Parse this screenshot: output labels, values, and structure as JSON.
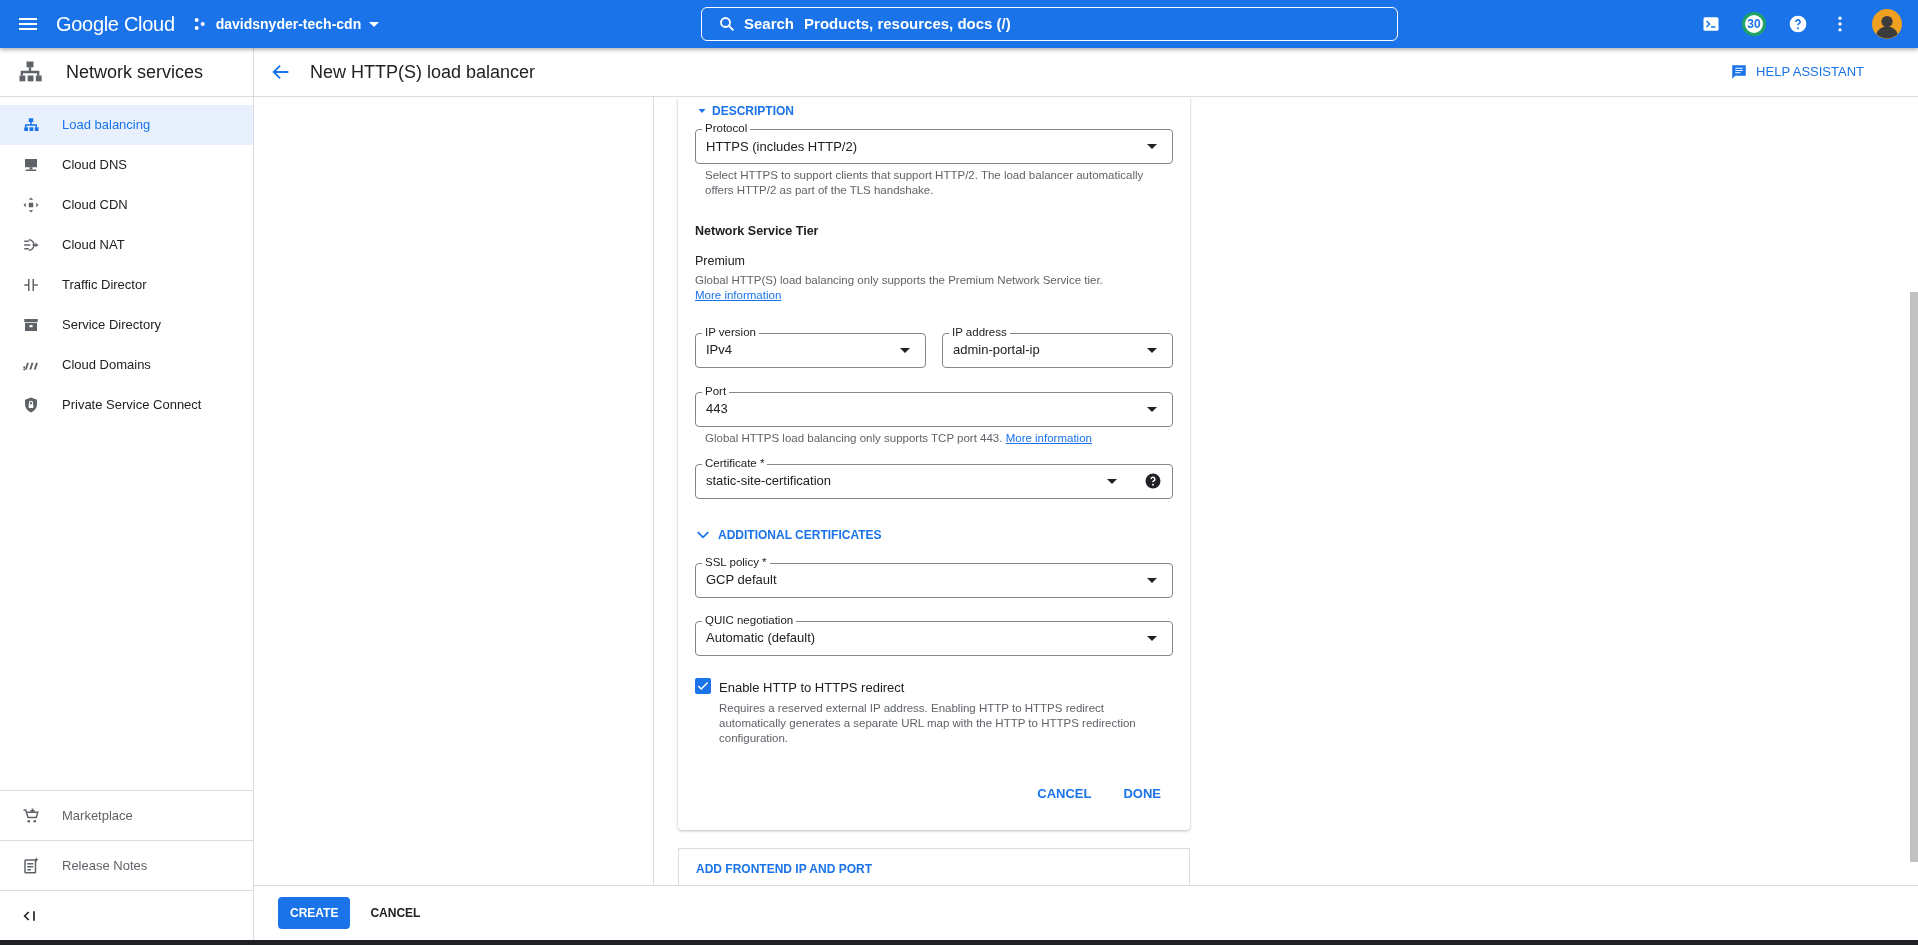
{
  "topbar": {
    "brand": "Google Cloud",
    "project": "davidsnyder-tech-cdn",
    "search": {
      "label": "Search",
      "placeholder": "Products, resources, docs (/)"
    },
    "notifications": "30"
  },
  "sidebar": {
    "title": "Network services",
    "items": [
      {
        "label": "Load balancing",
        "selected": true
      },
      {
        "label": "Cloud DNS",
        "selected": false
      },
      {
        "label": "Cloud CDN",
        "selected": false
      },
      {
        "label": "Cloud NAT",
        "selected": false
      },
      {
        "label": "Traffic Director",
        "selected": false
      },
      {
        "label": "Service Directory",
        "selected": false
      },
      {
        "label": "Cloud Domains",
        "selected": false
      },
      {
        "label": "Private Service Connect",
        "selected": false
      }
    ],
    "footer_items": [
      {
        "label": "Marketplace"
      },
      {
        "label": "Release Notes"
      }
    ]
  },
  "page": {
    "title": "New HTTP(S) load balancer",
    "help": "HELP ASSISTANT"
  },
  "form": {
    "section_toggle": "DESCRIPTION",
    "protocol": {
      "label": "Protocol",
      "value": "HTTPS (includes HTTP/2)",
      "hint": "Select HTTPS to support clients that support HTTP/2. The load balancer automatically offers HTTP/2 as part of the TLS handshake."
    },
    "tier": {
      "heading": "Network Service Tier",
      "value": "Premium",
      "note": "Global HTTP(S) load balancing only supports the Premium Network Service tier.",
      "link": "More information"
    },
    "ip_version": {
      "label": "IP version",
      "value": "IPv4"
    },
    "ip_address": {
      "label": "IP address",
      "value": "admin-portal-ip"
    },
    "port": {
      "label": "Port",
      "value": "443",
      "hint": "Global HTTPS load balancing only supports TCP port 443.",
      "link": "More information"
    },
    "certificate": {
      "label": "Certificate *",
      "value": "static-site-certification",
      "help": true
    },
    "additional": "ADDITIONAL CERTIFICATES",
    "ssl_policy": {
      "label": "SSL policy *",
      "value": "GCP default"
    },
    "quic": {
      "label": "QUIC negotiation",
      "value": "Automatic (default)"
    },
    "redirect": {
      "label": "Enable HTTP to HTTPS redirect",
      "checked": true,
      "hint": "Requires a reserved external IP address. Enabling HTTP to HTTPS redirect automatically generates a separate URL map with the HTTP to HTTPS redirection configuration."
    },
    "card_buttons": [
      "CANCEL",
      "DONE"
    ],
    "add_frontend": "ADD FRONTEND IP AND PORT"
  },
  "footer_buttons": [
    {
      "label": "CREATE",
      "primary": true
    },
    {
      "label": "CANCEL",
      "primary": false
    }
  ]
}
